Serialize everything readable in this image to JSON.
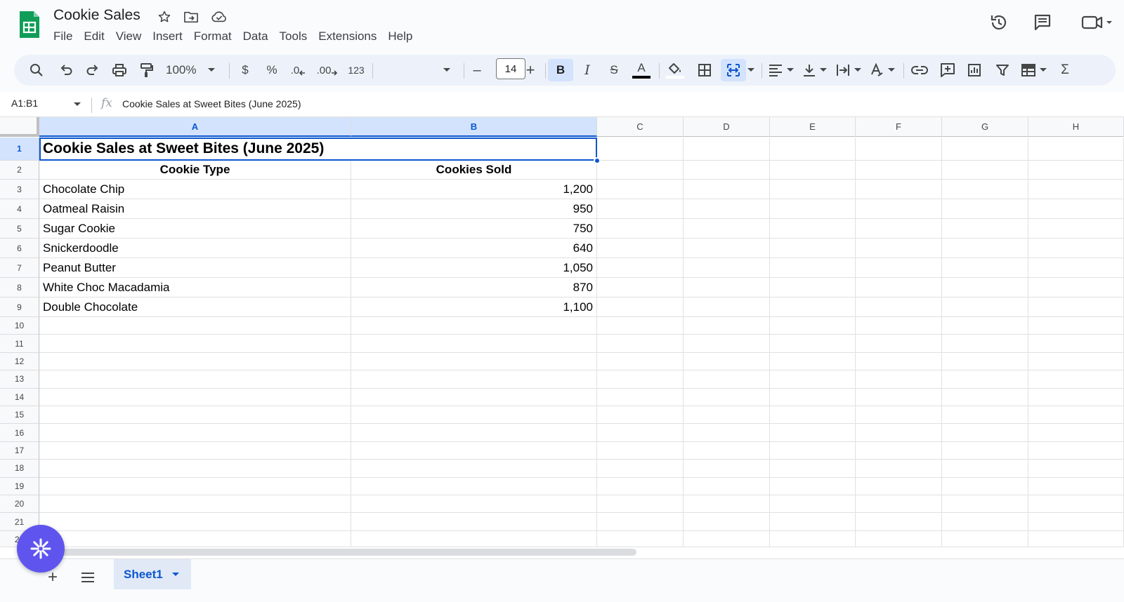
{
  "app": {
    "doc_title": "Cookie Sales",
    "menus": [
      "File",
      "Edit",
      "View",
      "Insert",
      "Format",
      "Data",
      "Tools",
      "Extensions",
      "Help"
    ]
  },
  "toolbar": {
    "zoom": "100%",
    "currency": "$",
    "percent": "%",
    "dec_decrease": ".0",
    "dec_increase": ".00",
    "number_format": "123",
    "font_name": "",
    "font_size": "14",
    "minus": "–",
    "plus": "+",
    "bold": "B",
    "italic": "I",
    "strike": "S",
    "text_color_letter": "A",
    "text_color": "#000000",
    "sum": "Σ"
  },
  "formula_bar": {
    "name_box": "A1:B1",
    "fx": "fx",
    "formula": "Cookie Sales at Sweet Bites (June 2025)"
  },
  "grid": {
    "columns": [
      "A",
      "B",
      "C",
      "D",
      "E",
      "F",
      "G",
      "H"
    ],
    "selected_columns": [
      "A",
      "B"
    ],
    "selected_row": 1,
    "rows": [
      "1",
      "2",
      "3",
      "4",
      "5",
      "6",
      "7",
      "8",
      "9",
      "10",
      "11",
      "12",
      "13",
      "14",
      "15",
      "16",
      "17",
      "18",
      "19",
      "20",
      "21",
      "22"
    ],
    "title": "Cookie Sales at Sweet Bites (June 2025)",
    "headers": [
      "Cookie Type",
      "Cookies Sold"
    ],
    "data": [
      {
        "type": "Chocolate Chip",
        "sold": "1,200"
      },
      {
        "type": "Oatmeal Raisin",
        "sold": "950"
      },
      {
        "type": "Sugar Cookie",
        "sold": "750"
      },
      {
        "type": "Snickerdoodle",
        "sold": "640"
      },
      {
        "type": "Peanut Butter",
        "sold": "1,050"
      },
      {
        "type": "White Choc Macadamia",
        "sold": "870"
      },
      {
        "type": "Double Chocolate",
        "sold": "1,100"
      }
    ]
  },
  "sheets": {
    "add": "+",
    "active": "Sheet1"
  },
  "colors": {
    "accent": "#0b57d0",
    "sheets_green": "#0f9d58",
    "fab": "#5f55ee"
  },
  "icons": {
    "fab": "asterisk-burst-icon"
  }
}
